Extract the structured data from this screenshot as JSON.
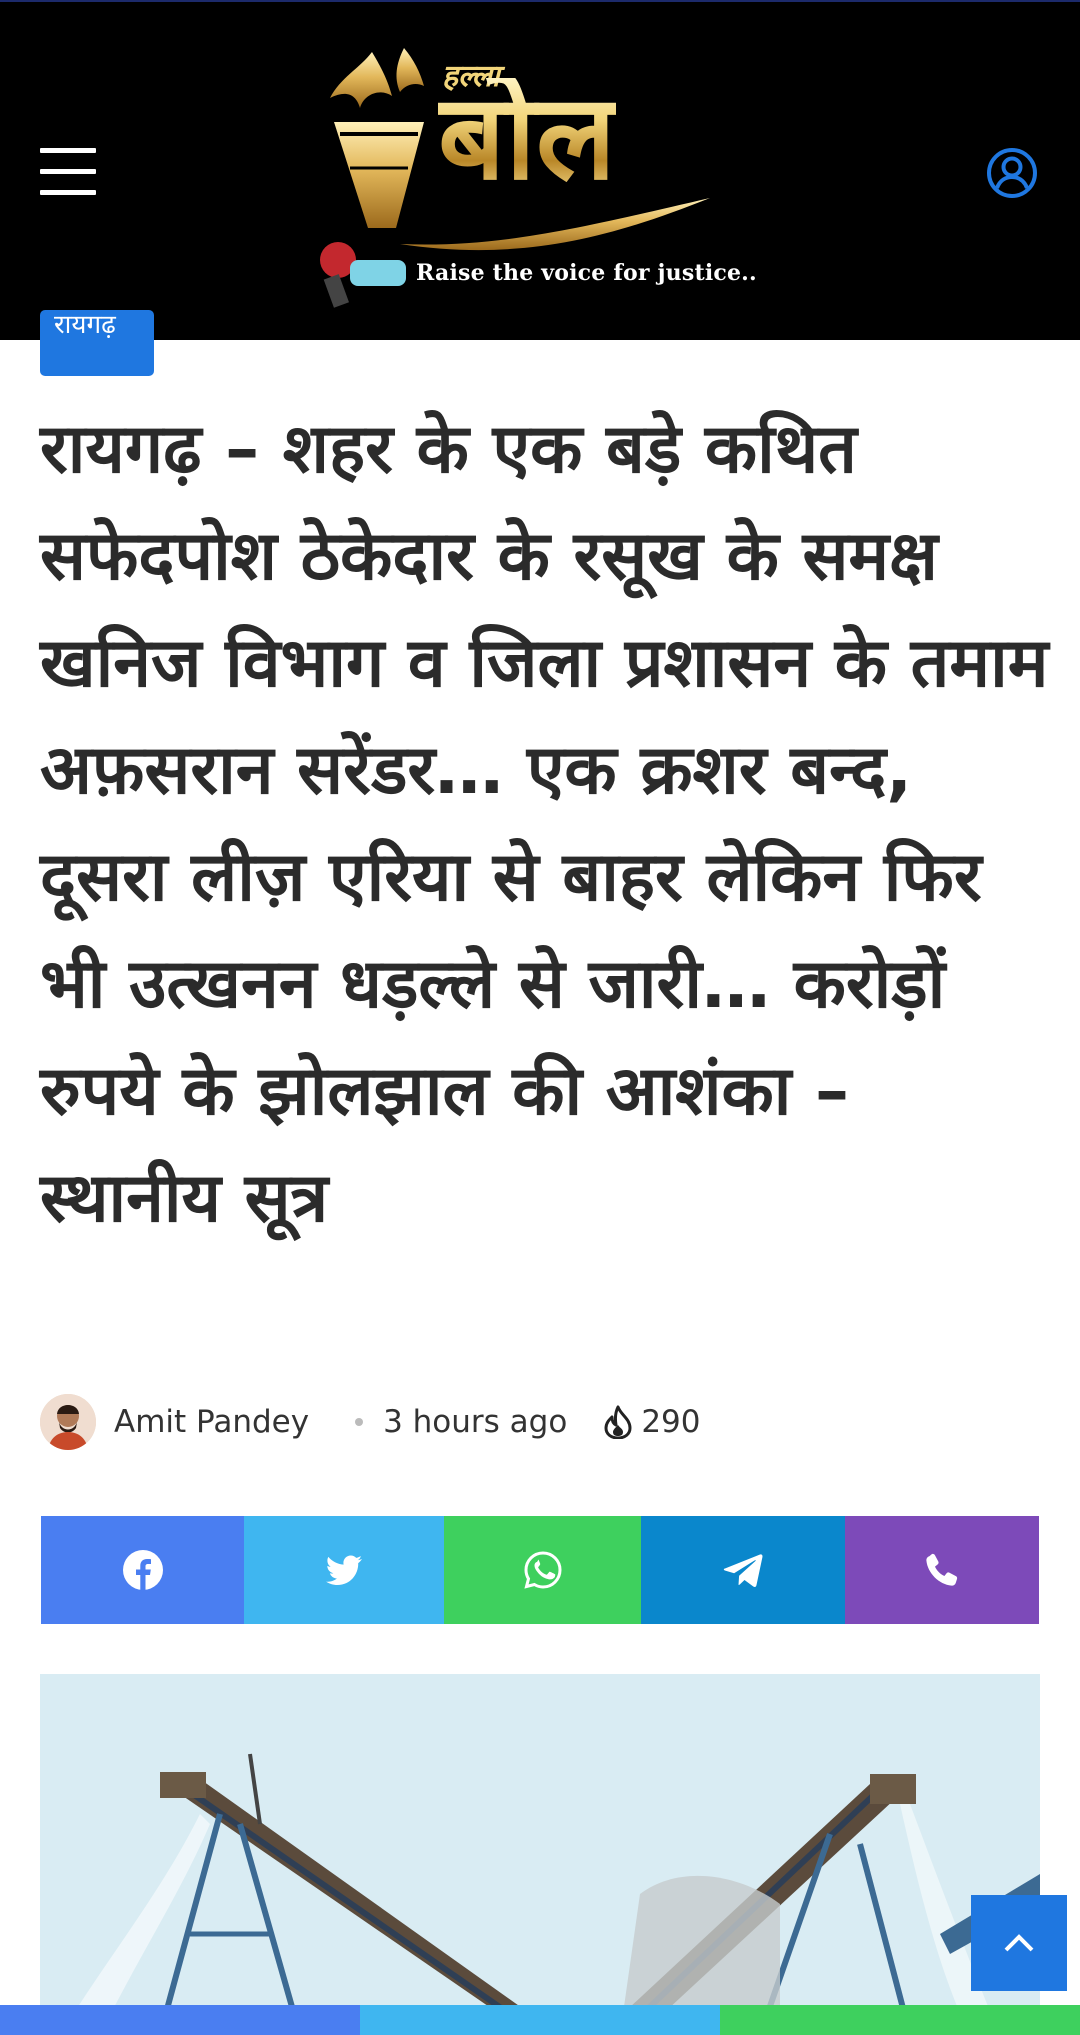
{
  "header": {
    "logo": {
      "small_text": "हल्ला",
      "big_text": "बोल",
      "tagline": "Raise the voice for justice.."
    },
    "menu_icon": "hamburger-menu-icon",
    "user_icon": "user-account-icon",
    "background_color": "#000000"
  },
  "article": {
    "category": "रायगढ़",
    "title": "रायगढ़ – शहर के एक बड़े कथित सफेदपोश ठेकेदार के रसूख के समक्ष खनिज विभाग व जिला प्रशासन के तमाम अफ़सरान सरेंडर… एक क्रशर बन्द, दूसरा लीज़ एरिया से बाहर लेकिन फिर भी उत्खनन धड़ल्ले से जारी… करोड़ों रुपये के झोलझाल की आशंका – स्थानीय सूत्र",
    "author": "Amit Pandey",
    "time": "3 hours ago",
    "views": "290",
    "views_icon": "fire-icon"
  },
  "share": [
    {
      "name": "facebook",
      "icon": "facebook-icon",
      "color": "#4a7ef1"
    },
    {
      "name": "twitter",
      "icon": "twitter-icon",
      "color": "#3fb6f0"
    },
    {
      "name": "whatsapp",
      "icon": "whatsapp-icon",
      "color": "#3ed05e"
    },
    {
      "name": "telegram",
      "icon": "telegram-icon",
      "color": "#0a87cc"
    },
    {
      "name": "phone",
      "icon": "phone-icon",
      "color": "#7d4ab9"
    }
  ],
  "colors": {
    "accent": "#1f77e0",
    "title_text": "#2b2b2b"
  },
  "back_to_top_icon": "chevron-up-icon"
}
